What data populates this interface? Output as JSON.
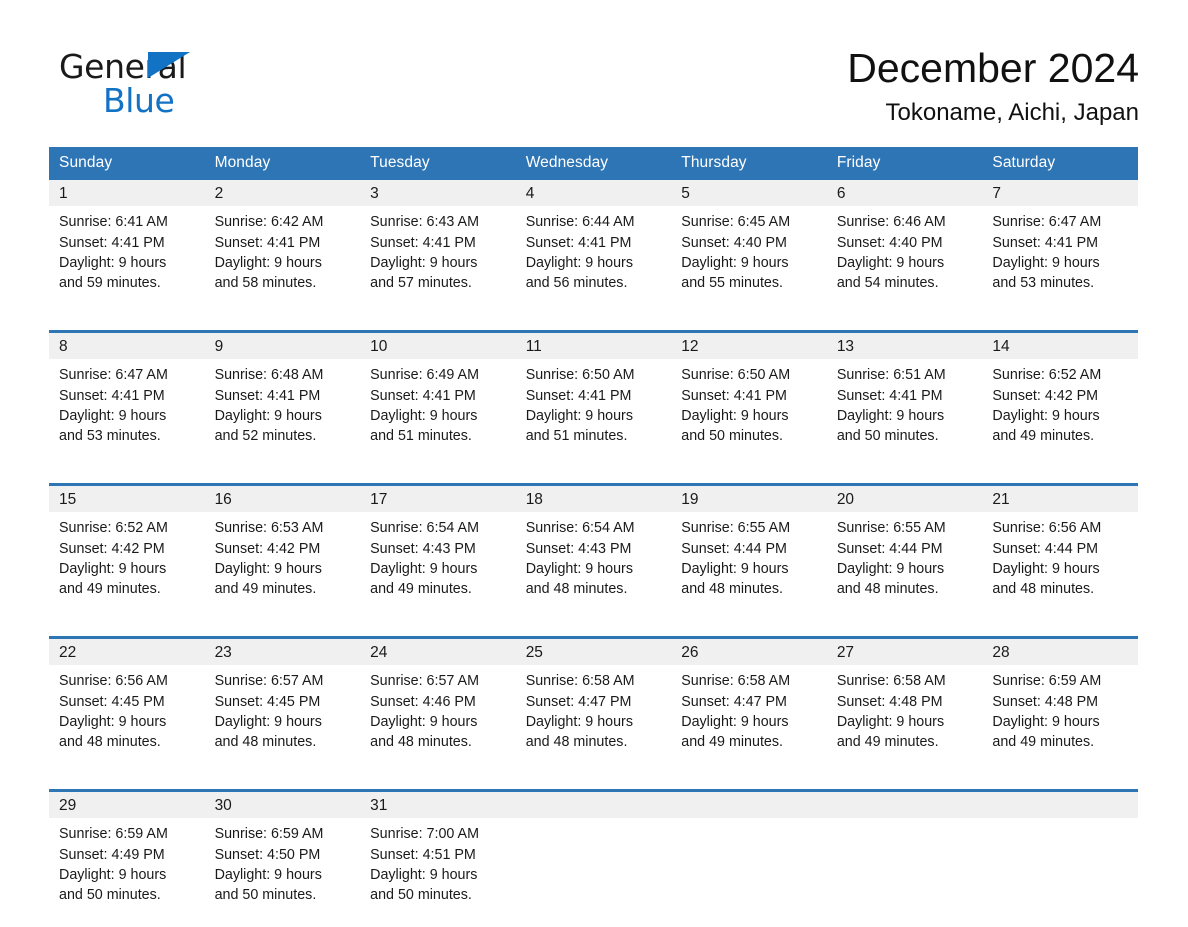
{
  "brand": {
    "name_part1": "General",
    "name_part2": "Blue",
    "triangle_color": "#1272c4"
  },
  "header": {
    "month_title": "December 2024",
    "location": "Tokoname, Aichi, Japan"
  },
  "theme": {
    "header_blue": "#2e75b6",
    "band_gray": "#f0f0f0",
    "text": "#1a1a1a"
  },
  "calendar": {
    "weekday_headers": [
      "Sunday",
      "Monday",
      "Tuesday",
      "Wednesday",
      "Thursday",
      "Friday",
      "Saturday"
    ],
    "weeks": [
      [
        {
          "day": "1",
          "sunrise": "Sunrise: 6:41 AM",
          "sunset": "Sunset: 4:41 PM",
          "daylight1": "Daylight: 9 hours",
          "daylight2": "and 59 minutes."
        },
        {
          "day": "2",
          "sunrise": "Sunrise: 6:42 AM",
          "sunset": "Sunset: 4:41 PM",
          "daylight1": "Daylight: 9 hours",
          "daylight2": "and 58 minutes."
        },
        {
          "day": "3",
          "sunrise": "Sunrise: 6:43 AM",
          "sunset": "Sunset: 4:41 PM",
          "daylight1": "Daylight: 9 hours",
          "daylight2": "and 57 minutes."
        },
        {
          "day": "4",
          "sunrise": "Sunrise: 6:44 AM",
          "sunset": "Sunset: 4:41 PM",
          "daylight1": "Daylight: 9 hours",
          "daylight2": "and 56 minutes."
        },
        {
          "day": "5",
          "sunrise": "Sunrise: 6:45 AM",
          "sunset": "Sunset: 4:40 PM",
          "daylight1": "Daylight: 9 hours",
          "daylight2": "and 55 minutes."
        },
        {
          "day": "6",
          "sunrise": "Sunrise: 6:46 AM",
          "sunset": "Sunset: 4:40 PM",
          "daylight1": "Daylight: 9 hours",
          "daylight2": "and 54 minutes."
        },
        {
          "day": "7",
          "sunrise": "Sunrise: 6:47 AM",
          "sunset": "Sunset: 4:41 PM",
          "daylight1": "Daylight: 9 hours",
          "daylight2": "and 53 minutes."
        }
      ],
      [
        {
          "day": "8",
          "sunrise": "Sunrise: 6:47 AM",
          "sunset": "Sunset: 4:41 PM",
          "daylight1": "Daylight: 9 hours",
          "daylight2": "and 53 minutes."
        },
        {
          "day": "9",
          "sunrise": "Sunrise: 6:48 AM",
          "sunset": "Sunset: 4:41 PM",
          "daylight1": "Daylight: 9 hours",
          "daylight2": "and 52 minutes."
        },
        {
          "day": "10",
          "sunrise": "Sunrise: 6:49 AM",
          "sunset": "Sunset: 4:41 PM",
          "daylight1": "Daylight: 9 hours",
          "daylight2": "and 51 minutes."
        },
        {
          "day": "11",
          "sunrise": "Sunrise: 6:50 AM",
          "sunset": "Sunset: 4:41 PM",
          "daylight1": "Daylight: 9 hours",
          "daylight2": "and 51 minutes."
        },
        {
          "day": "12",
          "sunrise": "Sunrise: 6:50 AM",
          "sunset": "Sunset: 4:41 PM",
          "daylight1": "Daylight: 9 hours",
          "daylight2": "and 50 minutes."
        },
        {
          "day": "13",
          "sunrise": "Sunrise: 6:51 AM",
          "sunset": "Sunset: 4:41 PM",
          "daylight1": "Daylight: 9 hours",
          "daylight2": "and 50 minutes."
        },
        {
          "day": "14",
          "sunrise": "Sunrise: 6:52 AM",
          "sunset": "Sunset: 4:42 PM",
          "daylight1": "Daylight: 9 hours",
          "daylight2": "and 49 minutes."
        }
      ],
      [
        {
          "day": "15",
          "sunrise": "Sunrise: 6:52 AM",
          "sunset": "Sunset: 4:42 PM",
          "daylight1": "Daylight: 9 hours",
          "daylight2": "and 49 minutes."
        },
        {
          "day": "16",
          "sunrise": "Sunrise: 6:53 AM",
          "sunset": "Sunset: 4:42 PM",
          "daylight1": "Daylight: 9 hours",
          "daylight2": "and 49 minutes."
        },
        {
          "day": "17",
          "sunrise": "Sunrise: 6:54 AM",
          "sunset": "Sunset: 4:43 PM",
          "daylight1": "Daylight: 9 hours",
          "daylight2": "and 49 minutes."
        },
        {
          "day": "18",
          "sunrise": "Sunrise: 6:54 AM",
          "sunset": "Sunset: 4:43 PM",
          "daylight1": "Daylight: 9 hours",
          "daylight2": "and 48 minutes."
        },
        {
          "day": "19",
          "sunrise": "Sunrise: 6:55 AM",
          "sunset": "Sunset: 4:44 PM",
          "daylight1": "Daylight: 9 hours",
          "daylight2": "and 48 minutes."
        },
        {
          "day": "20",
          "sunrise": "Sunrise: 6:55 AM",
          "sunset": "Sunset: 4:44 PM",
          "daylight1": "Daylight: 9 hours",
          "daylight2": "and 48 minutes."
        },
        {
          "day": "21",
          "sunrise": "Sunrise: 6:56 AM",
          "sunset": "Sunset: 4:44 PM",
          "daylight1": "Daylight: 9 hours",
          "daylight2": "and 48 minutes."
        }
      ],
      [
        {
          "day": "22",
          "sunrise": "Sunrise: 6:56 AM",
          "sunset": "Sunset: 4:45 PM",
          "daylight1": "Daylight: 9 hours",
          "daylight2": "and 48 minutes."
        },
        {
          "day": "23",
          "sunrise": "Sunrise: 6:57 AM",
          "sunset": "Sunset: 4:45 PM",
          "daylight1": "Daylight: 9 hours",
          "daylight2": "and 48 minutes."
        },
        {
          "day": "24",
          "sunrise": "Sunrise: 6:57 AM",
          "sunset": "Sunset: 4:46 PM",
          "daylight1": "Daylight: 9 hours",
          "daylight2": "and 48 minutes."
        },
        {
          "day": "25",
          "sunrise": "Sunrise: 6:58 AM",
          "sunset": "Sunset: 4:47 PM",
          "daylight1": "Daylight: 9 hours",
          "daylight2": "and 48 minutes."
        },
        {
          "day": "26",
          "sunrise": "Sunrise: 6:58 AM",
          "sunset": "Sunset: 4:47 PM",
          "daylight1": "Daylight: 9 hours",
          "daylight2": "and 49 minutes."
        },
        {
          "day": "27",
          "sunrise": "Sunrise: 6:58 AM",
          "sunset": "Sunset: 4:48 PM",
          "daylight1": "Daylight: 9 hours",
          "daylight2": "and 49 minutes."
        },
        {
          "day": "28",
          "sunrise": "Sunrise: 6:59 AM",
          "sunset": "Sunset: 4:48 PM",
          "daylight1": "Daylight: 9 hours",
          "daylight2": "and 49 minutes."
        }
      ],
      [
        {
          "day": "29",
          "sunrise": "Sunrise: 6:59 AM",
          "sunset": "Sunset: 4:49 PM",
          "daylight1": "Daylight: 9 hours",
          "daylight2": "and 50 minutes."
        },
        {
          "day": "30",
          "sunrise": "Sunrise: 6:59 AM",
          "sunset": "Sunset: 4:50 PM",
          "daylight1": "Daylight: 9 hours",
          "daylight2": "and 50 minutes."
        },
        {
          "day": "31",
          "sunrise": "Sunrise: 7:00 AM",
          "sunset": "Sunset: 4:51 PM",
          "daylight1": "Daylight: 9 hours",
          "daylight2": "and 50 minutes."
        },
        {
          "day": "",
          "sunrise": "",
          "sunset": "",
          "daylight1": "",
          "daylight2": ""
        },
        {
          "day": "",
          "sunrise": "",
          "sunset": "",
          "daylight1": "",
          "daylight2": ""
        },
        {
          "day": "",
          "sunrise": "",
          "sunset": "",
          "daylight1": "",
          "daylight2": ""
        },
        {
          "day": "",
          "sunrise": "",
          "sunset": "",
          "daylight1": "",
          "daylight2": ""
        }
      ]
    ]
  }
}
